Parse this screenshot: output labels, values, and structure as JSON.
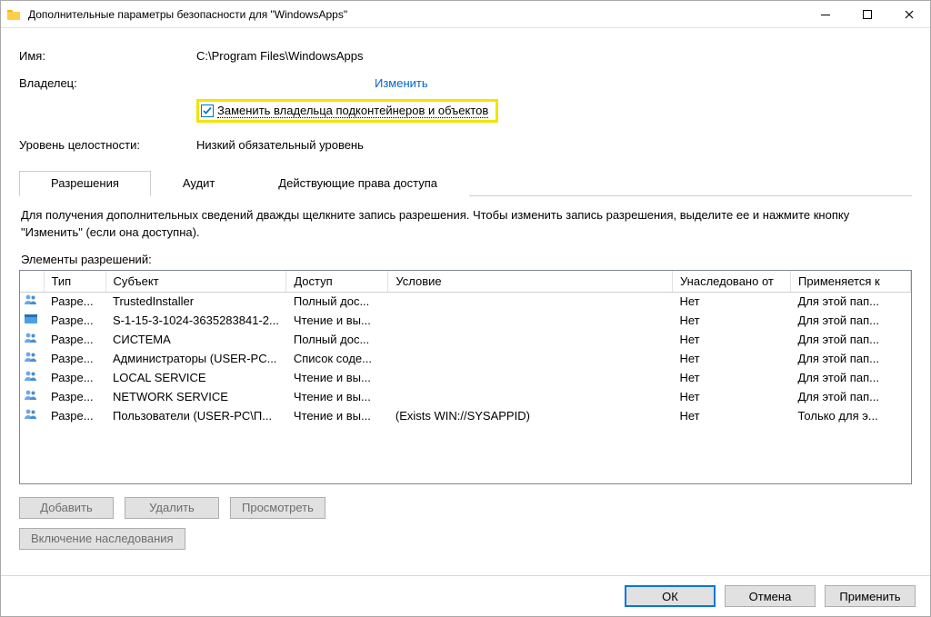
{
  "titlebar": {
    "title": "Дополнительные параметры безопасности  для \"WindowsApps\""
  },
  "labels": {
    "name": "Имя:",
    "owner": "Владелец:",
    "integrity": "Уровень целостности:"
  },
  "values": {
    "name": "C:\\Program Files\\WindowsApps",
    "owner_link": "Изменить",
    "replace_owner": "Заменить владельца подконтейнеров и объектов",
    "integrity": "Низкий обязательный уровень"
  },
  "tabs": {
    "perm": "Разрешения",
    "audit": "Аудит",
    "effective": "Действующие права доступа"
  },
  "hint": "Для получения дополнительных сведений дважды щелкните запись разрешения. Чтобы изменить запись разрешения, выделите ее и нажмите кнопку \"Изменить\" (если она доступна).",
  "section": "Элементы разрешений:",
  "columns": {
    "type": "Тип",
    "subject": "Субъект",
    "access": "Доступ",
    "condition": "Условие",
    "inherited": "Унаследовано от",
    "applies": "Применяется к"
  },
  "rows": [
    {
      "icon": "users",
      "type": "Разре...",
      "subject": "TrustedInstaller",
      "access": "Полный дос...",
      "condition": "",
      "inherited": "Нет",
      "applies": "Для этой пап..."
    },
    {
      "icon": "app",
      "type": "Разре...",
      "subject": "S-1-15-3-1024-3635283841-2...",
      "access": "Чтение и вы...",
      "condition": "",
      "inherited": "Нет",
      "applies": "Для этой пап..."
    },
    {
      "icon": "users",
      "type": "Разре...",
      "subject": "СИСТЕМА",
      "access": "Полный дос...",
      "condition": "",
      "inherited": "Нет",
      "applies": "Для этой пап..."
    },
    {
      "icon": "users",
      "type": "Разре...",
      "subject": "Администраторы (USER-PC...",
      "access": "Список соде...",
      "condition": "",
      "inherited": "Нет",
      "applies": "Для этой пап..."
    },
    {
      "icon": "users",
      "type": "Разре...",
      "subject": "LOCAL SERVICE",
      "access": "Чтение и вы...",
      "condition": "",
      "inherited": "Нет",
      "applies": "Для этой пап..."
    },
    {
      "icon": "users",
      "type": "Разре...",
      "subject": "NETWORK SERVICE",
      "access": "Чтение и вы...",
      "condition": "",
      "inherited": "Нет",
      "applies": "Для этой пап..."
    },
    {
      "icon": "users",
      "type": "Разре...",
      "subject": "Пользователи (USER-PC\\П...",
      "access": "Чтение и вы...",
      "condition": "(Exists WIN://SYSAPPID)",
      "inherited": "Нет",
      "applies": "Только для э..."
    }
  ],
  "buttons": {
    "add": "Добавить",
    "delete": "Удалить",
    "view": "Просмотреть",
    "inherit": "Включение наследования",
    "ok": "ОК",
    "cancel": "Отмена",
    "apply": "Применить"
  }
}
